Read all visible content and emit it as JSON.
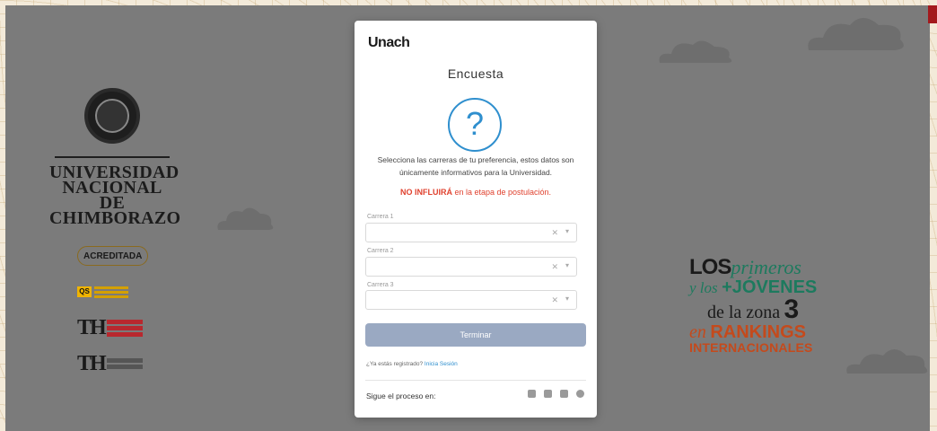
{
  "left_brand": {
    "univ_lines": [
      "UNIVERSIDAD",
      "NACIONAL DE",
      "CHIMBORAZO"
    ]
  },
  "badges": {
    "acreditada": "ACREDITADA",
    "qs_box": "QS"
  },
  "right_brand": {
    "los": "LOS",
    "primeros": "primeros",
    "y_los": "y los",
    "plus_jovenes": "+JÓVENES",
    "de_la_zona": "de la zona",
    "tres": "3",
    "en": "en",
    "rankings": "RANKINGS",
    "internacionales": "INTERNACIONALES"
  },
  "modal": {
    "logo": "Unach",
    "title": "Encuesta",
    "icon": "question-mark-icon",
    "description": "Selecciona las carreras de tu preferencia, estos datos son únicamente informativos para la Universidad.",
    "warning_strong": "NO INFLUIRÁ",
    "warning_rest": " en la etapa de postulación.",
    "fields": [
      {
        "label": "Carrera 1",
        "value": ""
      },
      {
        "label": "Carrera 2",
        "value": ""
      },
      {
        "label": "Carrera 3",
        "value": ""
      }
    ],
    "submit_label": "Terminar",
    "registered_text": "¿Ya estás registrado?",
    "login_link": "Inicia Sesión",
    "follow_text": "Sigue el proceso en:",
    "socials": [
      "facebook-icon",
      "twitter-icon",
      "instagram-icon",
      "web-icon"
    ]
  },
  "colors": {
    "overlay": "#7b7b7b",
    "accent_blue": "#2f8fce",
    "warning_red": "#e0422f",
    "button_disabled": "#9aa9c2"
  }
}
